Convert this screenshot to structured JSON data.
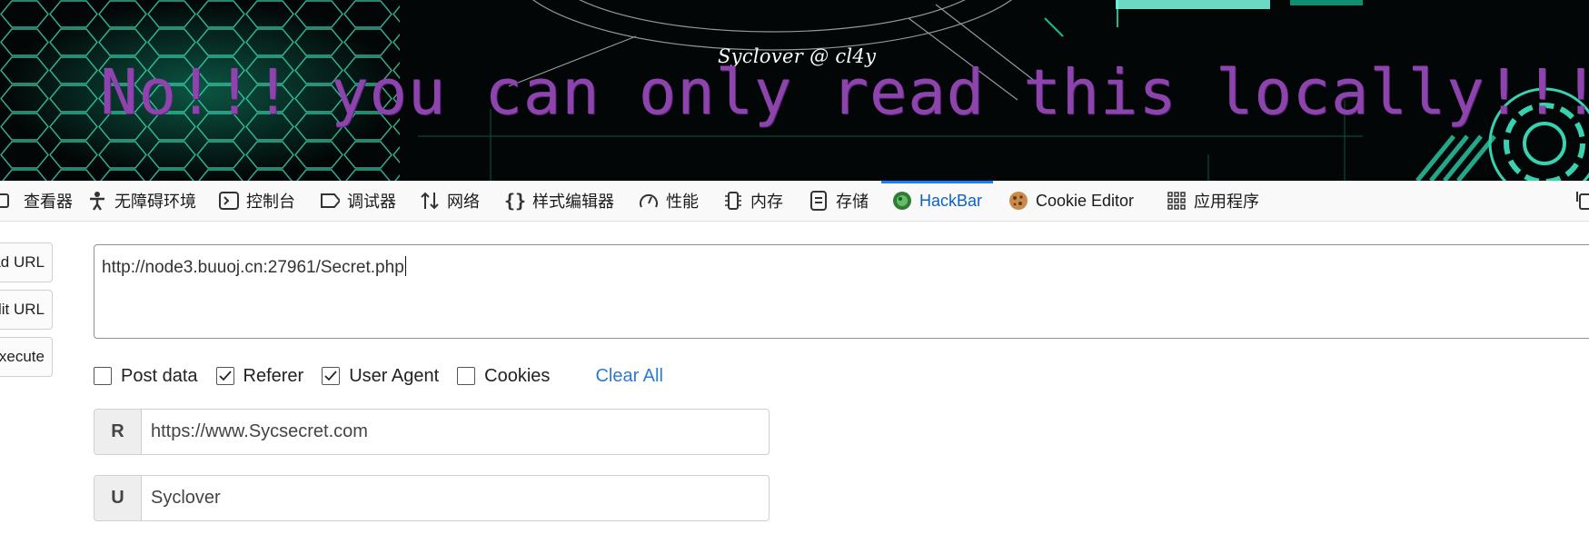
{
  "banner": {
    "credit": "Syclover @ cl4y",
    "headline": "No!!! you can only read this locally!!!"
  },
  "devtools": {
    "tabs": [
      {
        "label": "查看器",
        "icon": "inspector-icon"
      },
      {
        "label": "无障碍环境",
        "icon": "accessibility-icon"
      },
      {
        "label": "控制台",
        "icon": "console-icon"
      },
      {
        "label": "调试器",
        "icon": "debugger-icon"
      },
      {
        "label": "网络",
        "icon": "network-icon"
      },
      {
        "label": "样式编辑器",
        "icon": "style-editor-icon"
      },
      {
        "label": "性能",
        "icon": "performance-icon"
      },
      {
        "label": "内存",
        "icon": "memory-icon"
      },
      {
        "label": "存储",
        "icon": "storage-icon"
      },
      {
        "label": "HackBar",
        "icon": "hackbar-icon",
        "active": true
      },
      {
        "label": "Cookie Editor",
        "icon": "cookie-icon"
      },
      {
        "label": "应用程序",
        "icon": "application-grid-icon"
      }
    ]
  },
  "hackbar": {
    "buttons": {
      "load": "Load URL",
      "split": "Split URL",
      "execute": "Execute"
    },
    "url": "http://node3.buuoj.cn:27961/Secret.php",
    "options": {
      "post_data": {
        "label": "Post data",
        "checked": false
      },
      "referer": {
        "label": "Referer",
        "checked": true
      },
      "user_agent": {
        "label": "User Agent",
        "checked": true
      },
      "cookies": {
        "label": "Cookies",
        "checked": false
      },
      "clear_all": "Clear All"
    },
    "headers": {
      "referer": {
        "tag": "R",
        "value": "https://www.Sycsecret.com"
      },
      "user_agent": {
        "tag": "U",
        "value": "Syclover"
      }
    }
  },
  "colors": {
    "headline": "#8e44ad",
    "active_tab": "#0b63c8",
    "link": "#2b7bd1",
    "banner_bg": "#020606",
    "hex_grid": "#3fe0b8"
  }
}
